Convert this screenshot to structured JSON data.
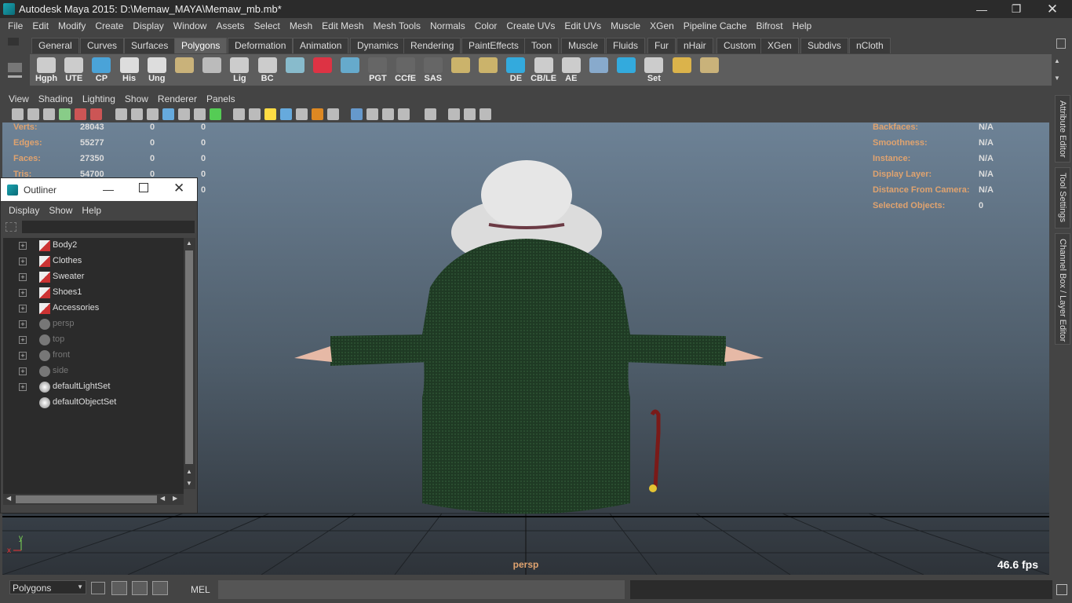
{
  "window": {
    "title": "Autodesk Maya 2015: D:\\Memaw_MAYA\\Memaw_mb.mb*"
  },
  "menu": [
    "File",
    "Edit",
    "Modify",
    "Create",
    "Display",
    "Window",
    "Assets",
    "Select",
    "Mesh",
    "Edit Mesh",
    "Mesh Tools",
    "Normals",
    "Color",
    "Create UVs",
    "Edit UVs",
    "Muscle",
    "XGen",
    "Pipeline Cache",
    "Bifrost",
    "Help"
  ],
  "shelf_tabs": [
    "General",
    "Curves",
    "Surfaces",
    "Polygons",
    "Deformation",
    "Animation",
    "Dynamics",
    "Rendering",
    "PaintEffects",
    "Toon",
    "Muscle",
    "Fluids",
    "Fur",
    "nHair",
    "Custom",
    "XGen",
    "Subdivs",
    "nCloth"
  ],
  "shelf_buttons": [
    "Hgph",
    "UTE",
    "CP",
    "His",
    "Ung",
    "",
    "",
    "Lig",
    "BC",
    "",
    "",
    "",
    "PGT",
    "CCfE",
    "SAS",
    "",
    "",
    "DE",
    "CB/LE",
    "AE",
    "",
    "",
    "Set",
    "",
    ""
  ],
  "panel_menu": [
    "View",
    "Shading",
    "Lighting",
    "Show",
    "Renderer",
    "Panels"
  ],
  "hud_left": [
    {
      "label": "Verts:",
      "v": [
        "28043",
        "0",
        "0"
      ]
    },
    {
      "label": "Edges:",
      "v": [
        "55277",
        "0",
        "0"
      ]
    },
    {
      "label": "Faces:",
      "v": [
        "27350",
        "0",
        "0"
      ]
    },
    {
      "label": "Tris:",
      "v": [
        "54700",
        "0",
        "0"
      ]
    },
    {
      "label": "",
      "v": [
        "",
        "",
        "0"
      ]
    }
  ],
  "hud_right": [
    {
      "label": "Backfaces:",
      "v": "N/A"
    },
    {
      "label": "Smoothness:",
      "v": "N/A"
    },
    {
      "label": "Instance:",
      "v": "N/A"
    },
    {
      "label": "Display Layer:",
      "v": "N/A"
    },
    {
      "label": "Distance From Camera:",
      "v": "N/A"
    },
    {
      "label": "Selected Objects:",
      "v": "0"
    }
  ],
  "viewport": {
    "camera": "persp",
    "fps": "46.6 fps",
    "axis_x": "x",
    "axis_y": "y"
  },
  "outliner": {
    "title": "Outliner",
    "menu": [
      "Display",
      "Show",
      "Help"
    ],
    "items": [
      {
        "name": "Body2",
        "kind": "mesh",
        "dim": false,
        "exp": true
      },
      {
        "name": "Clothes",
        "kind": "mesh",
        "dim": false,
        "exp": true
      },
      {
        "name": "Sweater",
        "kind": "mesh",
        "dim": false,
        "exp": true
      },
      {
        "name": "Shoes1",
        "kind": "mesh",
        "dim": false,
        "exp": true
      },
      {
        "name": "Accessories",
        "kind": "mesh",
        "dim": false,
        "exp": true
      },
      {
        "name": "persp",
        "kind": "camera",
        "dim": true,
        "exp": true
      },
      {
        "name": "top",
        "kind": "camera",
        "dim": true,
        "exp": true
      },
      {
        "name": "front",
        "kind": "camera",
        "dim": true,
        "exp": true
      },
      {
        "name": "side",
        "kind": "camera",
        "dim": true,
        "exp": true
      },
      {
        "name": "defaultLightSet",
        "kind": "set",
        "dim": false,
        "exp": true
      },
      {
        "name": "defaultObjectSet",
        "kind": "set",
        "dim": false,
        "exp": false
      }
    ]
  },
  "right_tabs": [
    "Attribute Editor",
    "Tool Settings",
    "Channel Box / Layer Editor"
  ],
  "bottom": {
    "menuset": "Polygons",
    "mel": "MEL"
  }
}
